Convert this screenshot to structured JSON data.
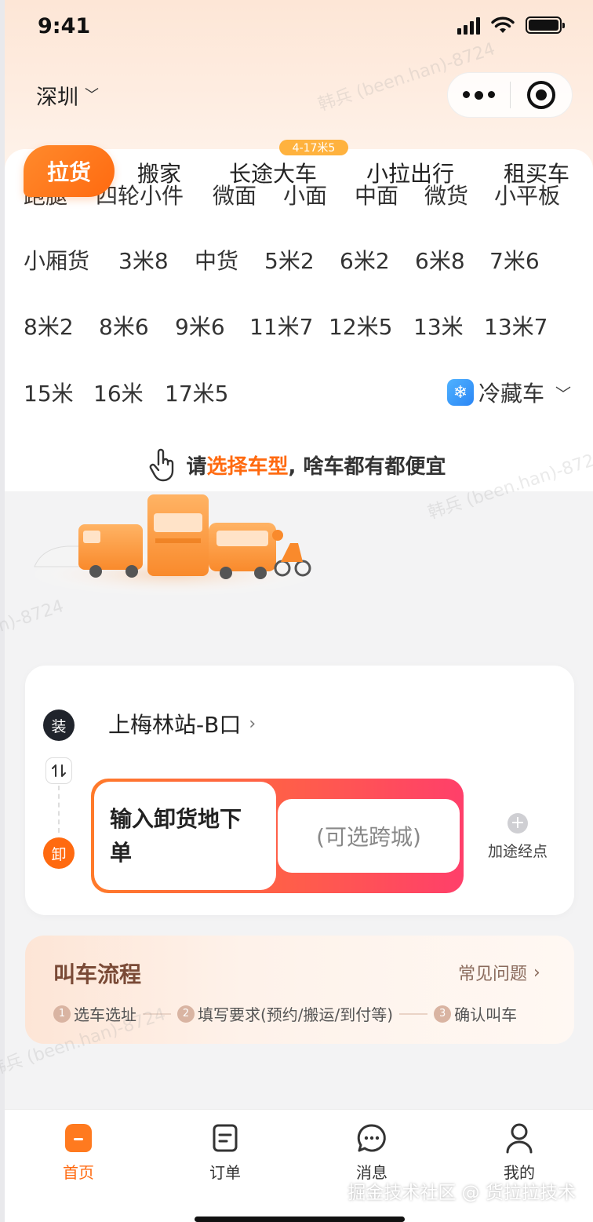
{
  "status_bar": {
    "time": "9:41"
  },
  "header": {
    "city": "深圳"
  },
  "tabs": {
    "active": "拉货",
    "items": [
      "搬家",
      "长途大车",
      "小拉出行",
      "租买车"
    ],
    "badge": "4-17米5"
  },
  "vehicles": {
    "row1": [
      "跑腿",
      "四轮小件",
      "微面",
      "小面",
      "中面",
      "微货",
      "小平板"
    ],
    "row2": [
      "小厢货",
      "3米8",
      "中货",
      "5米2",
      "6米2",
      "6米8",
      "7米6"
    ],
    "row3": [
      "8米2",
      "8米6",
      "9米6",
      "11米7",
      "12米5",
      "13米",
      "13米7"
    ],
    "row4": [
      "15米",
      "16米",
      "17米5"
    ],
    "cold_chain": "冷藏车"
  },
  "hint": {
    "prefix": "请",
    "highlight": "选择车型",
    "suffix": ", 啥车都有都便宜"
  },
  "address": {
    "load_badge": "装",
    "unload_badge": "卸",
    "load_location": "上梅林站-B口",
    "input_label": "输入卸货地下单",
    "cross_city": "(可选跨城)",
    "add_stop": "加途经点"
  },
  "process": {
    "title": "叫车流程",
    "faq": "常见问题",
    "steps": [
      {
        "n": "1",
        "label": "选车选址"
      },
      {
        "n": "2",
        "label": "填写要求(预约/搬运/到付等)"
      },
      {
        "n": "3",
        "label": "确认叫车"
      }
    ]
  },
  "nav": {
    "items": [
      {
        "label": "首页",
        "icon": "home-icon"
      },
      {
        "label": "订单",
        "icon": "order-icon"
      },
      {
        "label": "消息",
        "icon": "message-icon"
      },
      {
        "label": "我的",
        "icon": "profile-icon"
      }
    ]
  },
  "footer_watermark": "掘金技术社区 @ 货拉拉技术",
  "watermark_text": "韩兵 (been.han)-8724",
  "colors": {
    "accent": "#ff6a10",
    "dark": "#20242c",
    "cold_blue": "#2b86f5"
  }
}
